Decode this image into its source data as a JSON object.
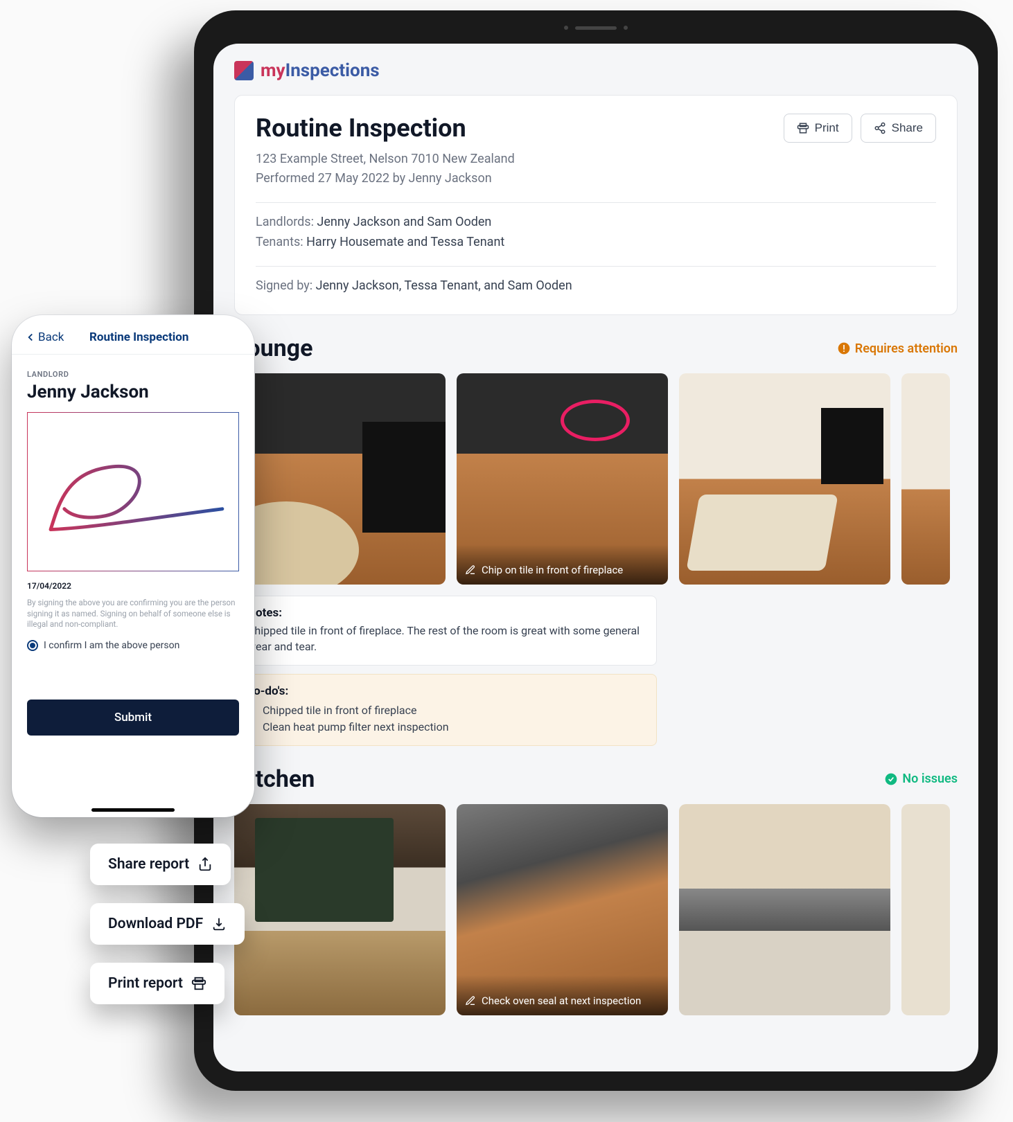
{
  "brand": {
    "prefix": "my",
    "suffix": "Inspections"
  },
  "report": {
    "title": "Routine Inspection",
    "address": "123 Example Street, Nelson 7010 New Zealand",
    "performed": "Performed 27 May 2022 by Jenny Jackson",
    "landlords_label": "Landlords:",
    "landlords": "Jenny Jackson and Sam Ooden",
    "tenants_label": "Tenants:",
    "tenants": "Harry Housemate and Tessa Tenant",
    "signed_label": "Signed by:",
    "signed": "Jenny Jackson, Tessa Tenant, and Sam Ooden",
    "print_btn": "Print",
    "share_btn": "Share"
  },
  "sections": {
    "lounge": {
      "title": "Lounge",
      "status": "Requires attention",
      "photo2_caption": "Chip on tile in front of fireplace",
      "notes_h": "Notes:",
      "notes": "Chipped tile in front of fireplace. The rest of the room is great with some general wear and tear.",
      "todos_h": "To-do's:",
      "todo1": "Chipped tile in front of fireplace",
      "todo2": "Clean heat pump filter next inspection"
    },
    "kitchen": {
      "title": "Kitchen",
      "status": "No issues",
      "photo2_caption": "Check oven seal at next inspection"
    }
  },
  "phone": {
    "back": "Back",
    "title": "Routine Inspection",
    "role_label": "LANDLORD",
    "signer": "Jenny Jackson",
    "date": "17/04/2022",
    "disclaimer": "By signing the above you are confirming you are the person signing it as named. Signing on behalf of someone else is illegal and non-compliant.",
    "confirm_label": "I confirm I am the above person",
    "submit": "Submit"
  },
  "chips": {
    "share": "Share report",
    "download": "Download PDF",
    "print": "Print report"
  }
}
